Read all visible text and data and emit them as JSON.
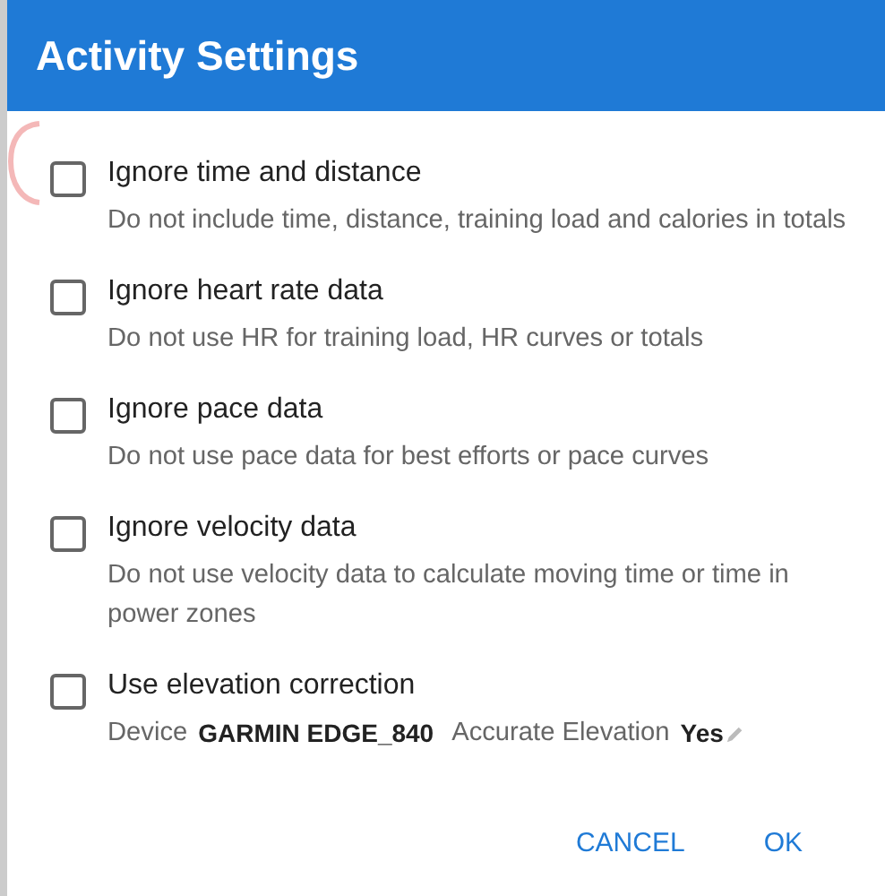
{
  "dialog": {
    "title": "Activity Settings"
  },
  "options": [
    {
      "kind": "text",
      "label": "Ignore time and distance",
      "checked": false,
      "description": "Do not include time, distance, training load and calories in totals"
    },
    {
      "kind": "text",
      "label": "Ignore heart rate data",
      "checked": false,
      "description": "Do not use HR for training load, HR curves or totals"
    },
    {
      "kind": "text",
      "label": "Ignore pace data",
      "checked": false,
      "description": "Do not use pace data for best efforts or pace curves"
    },
    {
      "kind": "text",
      "label": "Ignore velocity data",
      "checked": false,
      "description": "Do not use velocity data to calculate moving time or time in power zones"
    },
    {
      "kind": "device",
      "label": "Use elevation correction",
      "checked": false,
      "device_label": "Device",
      "device": "GARMIN EDGE_840",
      "accuracy_label": "Accurate Elevation",
      "accuracy": "Yes"
    }
  ],
  "buttons": [
    "CANCEL",
    "OK"
  ]
}
